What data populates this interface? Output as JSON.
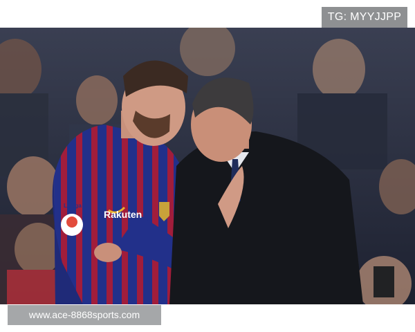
{
  "overlay": {
    "tg_tag": "TG: MYYJJPP",
    "site_banner": "www.ace-8868sports.com"
  },
  "photo": {
    "shirt_sponsor": "Rakuten",
    "sleeve_badge": "LaLiga",
    "colors": {
      "kit_blue": "#22308a",
      "kit_red": "#a11d3b",
      "coat": "#15171c",
      "tie": "#1f2c5a",
      "crowd": "#2a2f3d"
    }
  }
}
